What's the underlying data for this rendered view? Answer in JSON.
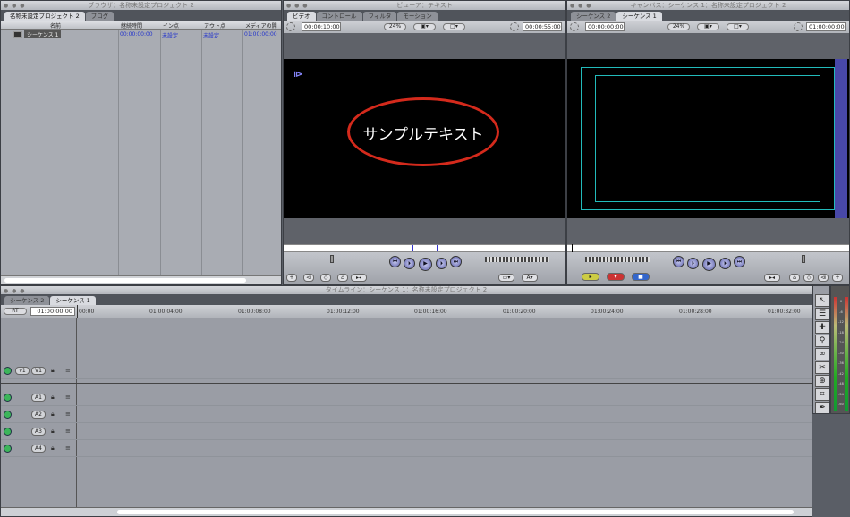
{
  "browser": {
    "title": "ブラウザ：名称未設定プロジェクト 2",
    "tabs": [
      "名称未設定プロジェクト 2",
      "ブログ"
    ],
    "columns": [
      "名前",
      "継続時間",
      "イン点",
      "アウト点",
      "メディアの開"
    ],
    "rows": [
      {
        "name": "シーケンス 1",
        "duration": "00:00:00:00",
        "in": "未設定",
        "out": "未設定",
        "media_start": "01:00:00:00"
      }
    ]
  },
  "viewer": {
    "title": "ビューア：テキスト",
    "tabs": [
      "ビデオ",
      "コントロール",
      "フィルタ",
      "モーション"
    ],
    "timecode": "00:00:10:00",
    "zoom": "24%",
    "duration": "00:00:55:00",
    "text": "サンプルテキスト",
    "annotation_color": "#d42a1c"
  },
  "canvas": {
    "title": "キャンバス：シーケンス 1：名称未設定プロジェクト 2",
    "tabs": [
      "シーケンス 2",
      "シーケンス 1"
    ],
    "timecode": "00:00:00:00",
    "zoom": "24%",
    "duration": "01:00:00:00"
  },
  "timeline": {
    "title": "タイムライン：シーケンス 1：名称未設定プロジェクト 2",
    "tabs": [
      "シーケンス 2",
      "シーケンス 1"
    ],
    "rt": "RT",
    "timecode": "01:00:00:00",
    "ruler": [
      "00:00",
      "01:00:04:00",
      "01:00:08:00",
      "01:00:12:00",
      "01:00:16:00",
      "01:00:20:00",
      "01:00:24:00",
      "01:00:28:00",
      "01:00:32:00"
    ],
    "video_tracks": [
      {
        "source": "v1",
        "dest": "V1"
      }
    ],
    "audio_tracks": [
      "A1",
      "A2",
      "A3",
      "A4"
    ]
  },
  "meters": {
    "labels": [
      "0",
      "-6",
      "-12",
      "-18",
      "-24",
      "-30",
      "-36",
      "-42",
      "-48",
      "-54",
      "-60"
    ]
  }
}
